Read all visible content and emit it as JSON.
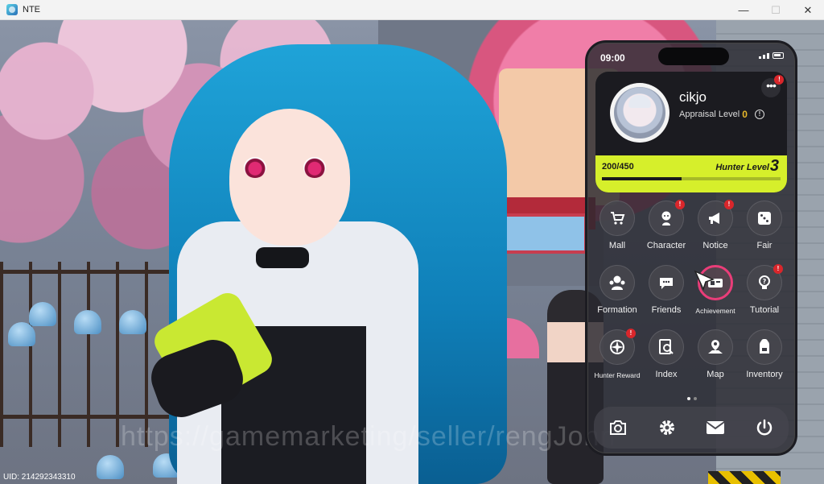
{
  "window": {
    "title": "NTE",
    "minimize": "—",
    "maximize": "☐",
    "close": "✕"
  },
  "scene": {
    "watermark": "https://gamemarketing/seller/rengJohn",
    "uid": "UID: 214292343310"
  },
  "phone": {
    "time": "09:00",
    "more_label": "•••",
    "more_badge": "!",
    "profile": {
      "username": "cikjo",
      "appraisal_label": "Appraisal Level",
      "appraisal_level": "0",
      "info_icon": "!",
      "exp": "200/450",
      "exp_fraction": 0.444,
      "hunter_label": "Hunter Level",
      "hunter_level": "3"
    },
    "apps": [
      {
        "label": "Mall",
        "icon": "cart-icon",
        "badge": false
      },
      {
        "label": "Character",
        "icon": "character-icon",
        "badge": true
      },
      {
        "label": "Notice",
        "icon": "megaphone-icon",
        "badge": true
      },
      {
        "label": "Fair",
        "icon": "dice-icon",
        "badge": false
      },
      {
        "label": "Formation",
        "icon": "formation-icon",
        "badge": false
      },
      {
        "label": "Friends",
        "icon": "chat-bubble-icon",
        "badge": false
      },
      {
        "label": "Achievement",
        "icon": "achievement-icon",
        "badge": false,
        "active": true
      },
      {
        "label": "Tutorial",
        "icon": "lightbulb-icon",
        "badge": true
      },
      {
        "label": "Hunter Reward",
        "icon": "compass-star-icon",
        "badge": true
      },
      {
        "label": "Index",
        "icon": "index-search-icon",
        "badge": false
      },
      {
        "label": "Map",
        "icon": "map-pin-icon",
        "badge": false
      },
      {
        "label": "Inventory",
        "icon": "backpack-icon",
        "badge": false
      }
    ],
    "badge_mark": "!",
    "dock": [
      {
        "icon": "camera-icon"
      },
      {
        "icon": "gear-icon"
      },
      {
        "icon": "mail-icon"
      },
      {
        "icon": "power-icon"
      }
    ],
    "accent": "#d6ef2b",
    "active_ring": "#ea3d79"
  }
}
